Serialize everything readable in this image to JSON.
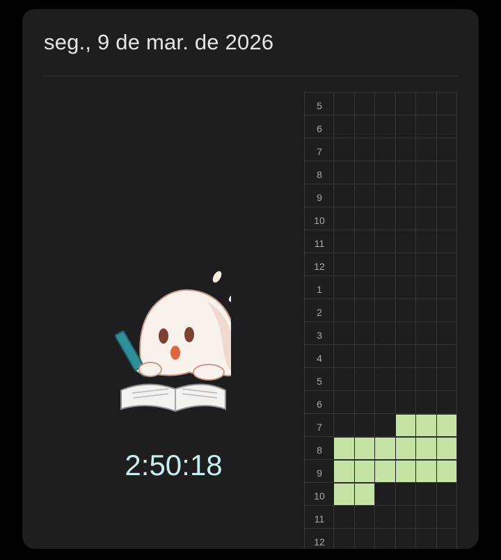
{
  "header": {
    "date": "seg., 9 de mar. de 2026"
  },
  "mascot": {
    "icon": "studying-ghost-icon"
  },
  "timer": {
    "value": "2:50:18"
  },
  "colors": {
    "filled": "#c5e3a4",
    "timer": "#c8eef2",
    "card": "#1e1e20"
  },
  "timeline": {
    "columns": 6,
    "rows": [
      {
        "hour": "5",
        "filled": [
          0,
          0,
          0,
          0,
          0,
          0
        ]
      },
      {
        "hour": "6",
        "filled": [
          0,
          0,
          0,
          0,
          0,
          0
        ]
      },
      {
        "hour": "7",
        "filled": [
          0,
          0,
          0,
          0,
          0,
          0
        ]
      },
      {
        "hour": "8",
        "filled": [
          0,
          0,
          0,
          0,
          0,
          0
        ]
      },
      {
        "hour": "9",
        "filled": [
          0,
          0,
          0,
          0,
          0,
          0
        ]
      },
      {
        "hour": "10",
        "filled": [
          0,
          0,
          0,
          0,
          0,
          0
        ]
      },
      {
        "hour": "11",
        "filled": [
          0,
          0,
          0,
          0,
          0,
          0
        ]
      },
      {
        "hour": "12",
        "filled": [
          0,
          0,
          0,
          0,
          0,
          0
        ]
      },
      {
        "hour": "1",
        "filled": [
          0,
          0,
          0,
          0,
          0,
          0
        ]
      },
      {
        "hour": "2",
        "filled": [
          0,
          0,
          0,
          0,
          0,
          0
        ]
      },
      {
        "hour": "3",
        "filled": [
          0,
          0,
          0,
          0,
          0,
          0
        ]
      },
      {
        "hour": "4",
        "filled": [
          0,
          0,
          0,
          0,
          0,
          0
        ]
      },
      {
        "hour": "5",
        "filled": [
          0,
          0,
          0,
          0,
          0,
          0
        ]
      },
      {
        "hour": "6",
        "filled": [
          0,
          0,
          0,
          0,
          0,
          0
        ]
      },
      {
        "hour": "7",
        "filled": [
          0,
          0,
          0,
          1,
          1,
          1
        ]
      },
      {
        "hour": "8",
        "filled": [
          1,
          1,
          1,
          1,
          1,
          1
        ]
      },
      {
        "hour": "9",
        "filled": [
          1,
          1,
          1,
          1,
          1,
          1
        ]
      },
      {
        "hour": "10",
        "filled": [
          1,
          1,
          0,
          0,
          0,
          0
        ]
      },
      {
        "hour": "11",
        "filled": [
          0,
          0,
          0,
          0,
          0,
          0
        ]
      },
      {
        "hour": "12",
        "filled": [
          0,
          0,
          0,
          0,
          0,
          0
        ]
      }
    ]
  }
}
